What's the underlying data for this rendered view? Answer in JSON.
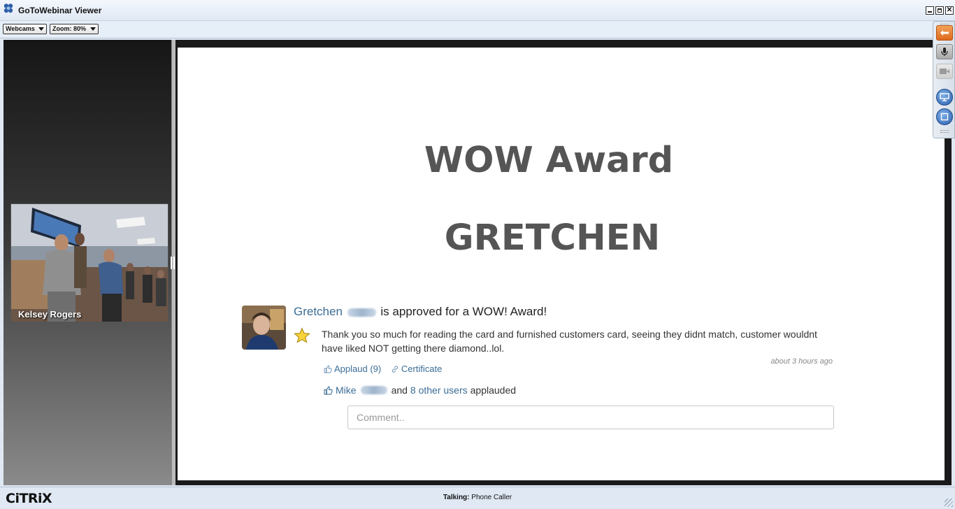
{
  "window": {
    "title": "GoToWebinar Viewer",
    "app_icon": "gotowebinar-flower-icon"
  },
  "toolbar": {
    "webcams_label": "Webcams",
    "zoom_label": "Zoom: 80%"
  },
  "webcam": {
    "presenter_name": "Kelsey Rogers"
  },
  "slide": {
    "title_line1": "WOW Award",
    "title_line2": "GRETCHEN",
    "post": {
      "first_name": "Gretchen",
      "approved_text": "is approved for a WOW! Award!",
      "body": "Thank you so much for reading the card and furnished customers card, seeing they didnt match, customer wouldnt have liked NOT getting there diamond..lol.",
      "time": "about 3 hours ago",
      "applaud_label": "Applaud (9)",
      "certificate_label": "Certificate",
      "applauder_first": "Mike",
      "and_text": "and",
      "others_link": "8 other users",
      "applauded_text": "applauded",
      "comment_placeholder": "Comment.."
    }
  },
  "status": {
    "talking_label": "Talking:",
    "talking_value": "Phone Caller",
    "brand": "CiTRiX"
  },
  "colors": {
    "accent_link": "#3b6d96",
    "slide_title": "#555555",
    "control_orange": "#dd6a1c"
  }
}
